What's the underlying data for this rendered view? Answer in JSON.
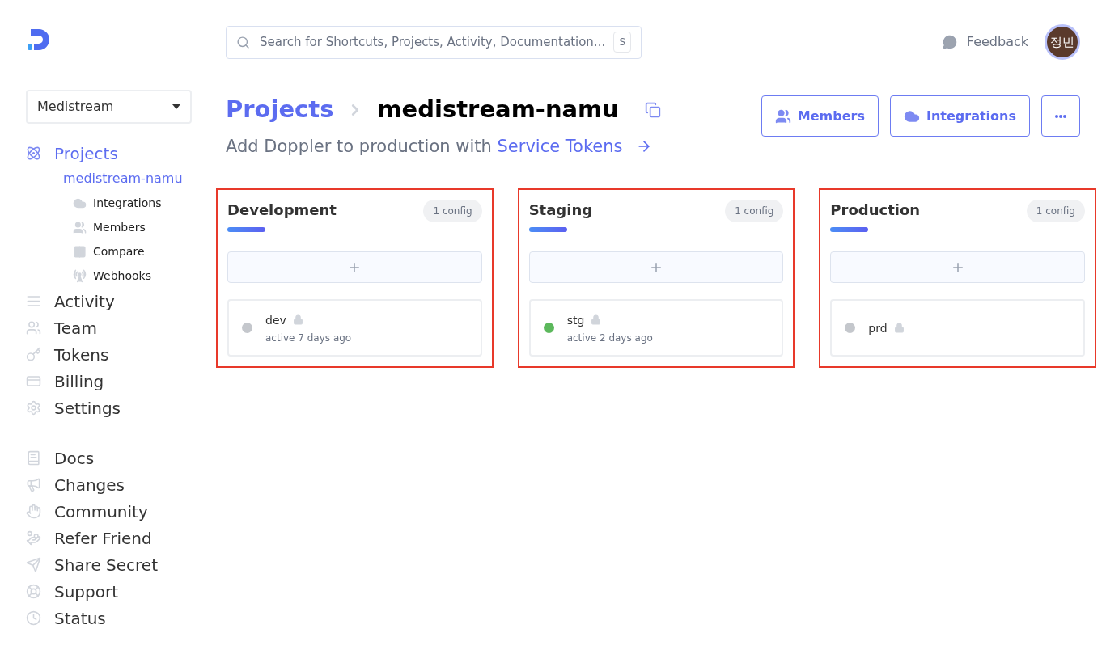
{
  "workplace_select": {
    "value": "Medistream"
  },
  "search": {
    "placeholder": "Search for Shortcuts, Projects, Activity, Documentation...",
    "shortcut": "S"
  },
  "feedback": "Feedback",
  "avatar": "정빈",
  "sidebar": {
    "primary": [
      {
        "label": "Projects",
        "selected": true,
        "children": [
          {
            "label": "medistream-namu",
            "selected": true,
            "children": [
              {
                "label": "Integrations"
              },
              {
                "label": "Members"
              },
              {
                "label": "Compare"
              },
              {
                "label": "Webhooks"
              }
            ]
          }
        ]
      },
      {
        "label": "Activity",
        "selected": false
      },
      {
        "label": "Team",
        "selected": false
      },
      {
        "label": "Tokens",
        "selected": false
      },
      {
        "label": "Billing",
        "selected": false
      },
      {
        "label": "Settings",
        "selected": false
      }
    ],
    "secondary": [
      {
        "label": "Docs"
      },
      {
        "label": "Changes"
      },
      {
        "label": "Community"
      },
      {
        "label": "Refer Friend"
      },
      {
        "label": "Share Secret"
      },
      {
        "label": "Support"
      },
      {
        "label": "Status"
      }
    ]
  },
  "breadcrumb": [
    "Projects",
    "medistream-namu"
  ],
  "subtitle": {
    "text": "Add Doppler to production with",
    "link": "Service Tokens"
  },
  "actions": [
    "Members",
    "Integrations"
  ],
  "environments": [
    {
      "name": "Development",
      "count": "1 config",
      "highlighted": true,
      "configs": [
        {
          "name": "dev",
          "locked": true,
          "activity": "active 7 days ago",
          "color": "#c4c7cc"
        }
      ]
    },
    {
      "name": "Staging",
      "count": "1 config",
      "highlighted": true,
      "configs": [
        {
          "name": "stg",
          "locked": true,
          "activity": "active 2 days ago",
          "color": "#5cb85c"
        }
      ]
    },
    {
      "name": "Production",
      "count": "1 config",
      "highlighted": true,
      "configs": [
        {
          "name": "prd",
          "locked": true,
          "color": "#c4c7cc"
        }
      ]
    }
  ]
}
